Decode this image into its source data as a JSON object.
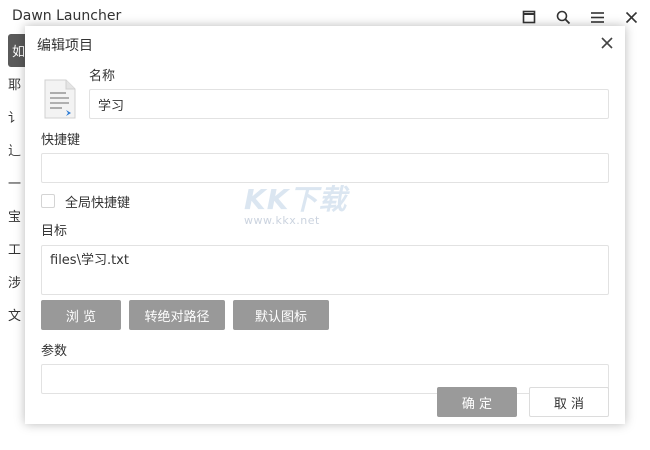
{
  "app": {
    "title": "Dawn Launcher"
  },
  "window_controls": {
    "icons": [
      "maximize-icon",
      "search-icon",
      "menu-icon",
      "close-icon"
    ]
  },
  "sidebar": {
    "items": [
      {
        "label": "如",
        "active": true
      },
      {
        "label": "耶",
        "active": false
      },
      {
        "label": "讠",
        "active": false
      },
      {
        "label": "辶",
        "active": false
      },
      {
        "label": "一",
        "active": false
      },
      {
        "label": "宝",
        "active": false
      },
      {
        "label": "工",
        "active": false
      },
      {
        "label": "涉",
        "active": false
      },
      {
        "label": "文",
        "active": false
      }
    ]
  },
  "dialog": {
    "title": "编辑项目",
    "name_label": "名称",
    "name_value": "学习",
    "shortcut_label": "快捷键",
    "shortcut_value": "",
    "global_shortcut_label": "全局快捷键",
    "global_shortcut_checked": false,
    "target_label": "目标",
    "target_value": "files\\学习.txt",
    "browse_button": "浏 览",
    "absolute_path_button": "转绝对路径",
    "default_icon_button": "默认图标",
    "params_label": "参数",
    "params_value": "",
    "ok_button": "确 定",
    "cancel_button": "取 消"
  },
  "watermark": {
    "brand": "KK下载",
    "url": "www.kkx.net"
  },
  "colors": {
    "button_gray": "#999999",
    "border": "#e2e2e2",
    "text": "#333333",
    "sidebar_active": "#5a5a5a"
  }
}
